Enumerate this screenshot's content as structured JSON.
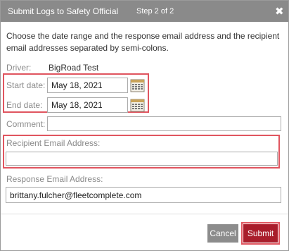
{
  "dialog": {
    "title": "Submit Logs to Safety Official",
    "step": "Step 2 of 2",
    "close_glyph": "✖"
  },
  "instructions": "Choose the date range and the response email address and the recipient email addresses separated by semi-colons.",
  "driver": {
    "label": "Driver:",
    "value": "BigRoad Test"
  },
  "start_date": {
    "label": "Start date:",
    "value": "May 18, 2021",
    "icon": "calendar-icon"
  },
  "end_date": {
    "label": "End date:",
    "value": "May 18, 2021",
    "icon": "calendar-icon"
  },
  "comment": {
    "label": "Comment:",
    "value": ""
  },
  "recipient": {
    "label": "Recipient Email Address:",
    "value": ""
  },
  "response": {
    "label": "Response Email Address:",
    "value": "brittany.fulcher@fleetcomplete.com"
  },
  "buttons": {
    "cancel": "Cancel",
    "submit": "Submit"
  },
  "colors": {
    "titlebar": "#8a8a8a",
    "highlight": "#e0555f",
    "submit": "#a91d2b",
    "cancel": "#8c8c8c"
  }
}
